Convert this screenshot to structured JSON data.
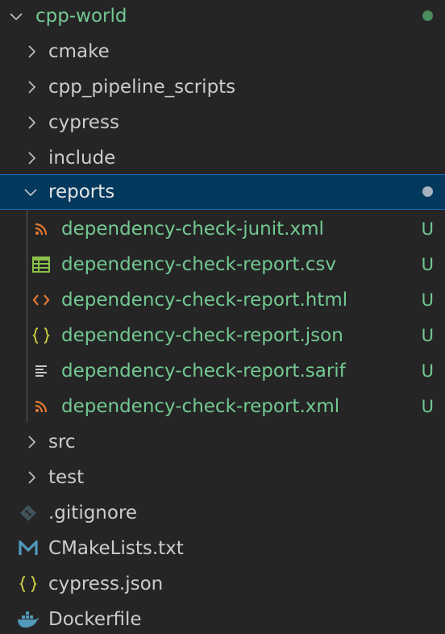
{
  "root": {
    "label": "cpp-world"
  },
  "folders_top": [
    {
      "label": "cmake"
    },
    {
      "label": "cpp_pipeline_scripts"
    },
    {
      "label": "cypress"
    },
    {
      "label": "include"
    }
  ],
  "reports": {
    "label": "reports",
    "files": [
      {
        "label": "dependency-check-junit.xml",
        "icon": "rss-icon",
        "status": "U"
      },
      {
        "label": "dependency-check-report.csv",
        "icon": "csv-table-icon",
        "status": "U"
      },
      {
        "label": "dependency-check-report.html",
        "icon": "html-code-icon",
        "status": "U"
      },
      {
        "label": "dependency-check-report.json",
        "icon": "json-braces-icon",
        "status": "U"
      },
      {
        "label": "dependency-check-report.sarif",
        "icon": "text-lines-icon",
        "status": "U"
      },
      {
        "label": "dependency-check-report.xml",
        "icon": "rss-icon",
        "status": "U"
      }
    ]
  },
  "folders_bottom": [
    {
      "label": "src"
    },
    {
      "label": "test"
    }
  ],
  "root_files": [
    {
      "label": ".gitignore",
      "icon": "git-icon"
    },
    {
      "label": "CMakeLists.txt",
      "icon": "cmake-m-icon"
    },
    {
      "label": "cypress.json",
      "icon": "json-braces-icon"
    },
    {
      "label": "Dockerfile",
      "icon": "docker-icon"
    }
  ],
  "colors": {
    "background": "#252526",
    "untracked_green": "#73c991",
    "selection": "#04395e",
    "selection_border": "#0e70c0"
  }
}
